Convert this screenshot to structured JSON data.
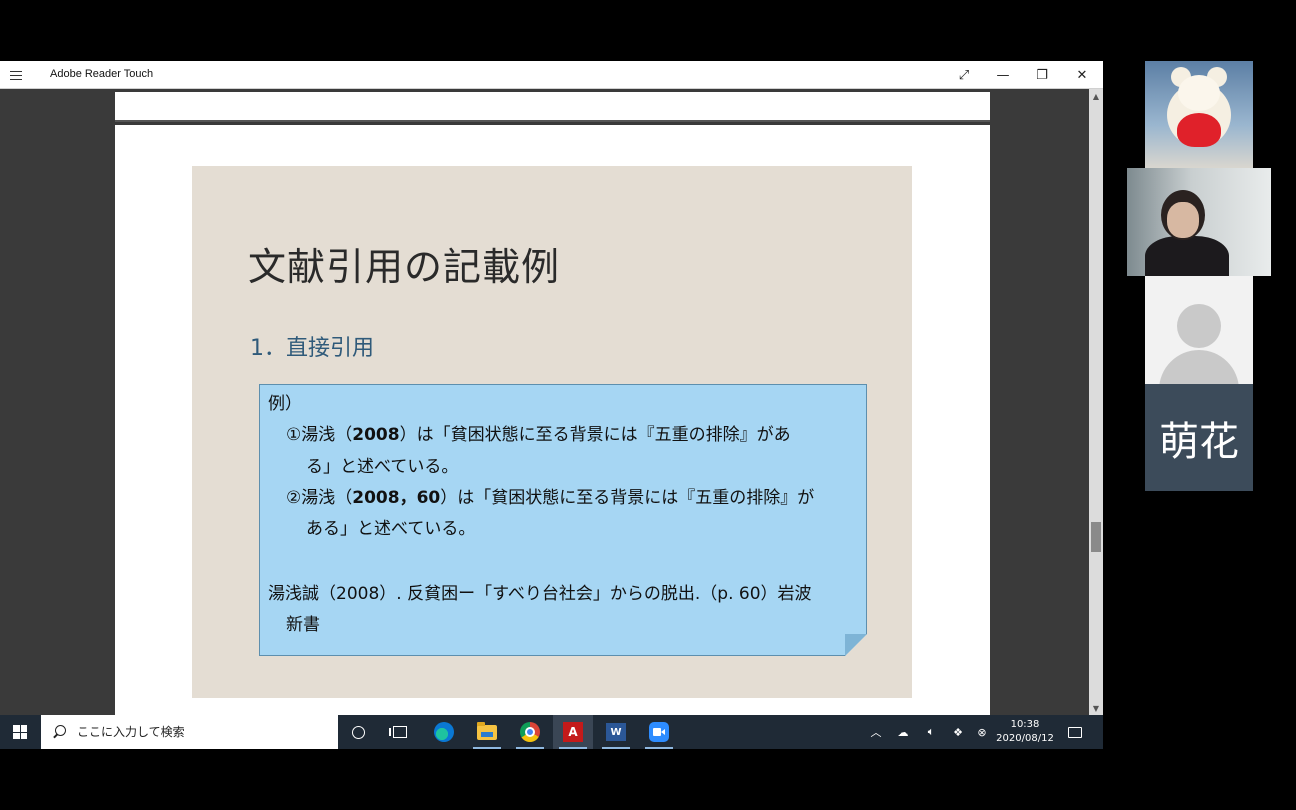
{
  "app": {
    "title": "Adobe Reader Touch",
    "window_buttons": {
      "fullscreen": "⤢",
      "minimize": "—",
      "restore": "❐",
      "close": "✕"
    }
  },
  "slide": {
    "title": "文献引用の記載例",
    "subtitle": "1．直接引用",
    "callout": {
      "label": "例）",
      "item1_a_pre": "①湯浅（",
      "item1_a_bold": "2008",
      "item1_a_post": "）は「貧困状態に至る背景には『五重の排除』があ",
      "item1_b": "る」と述べている。",
      "item2_a_pre": "②湯浅（",
      "item2_a_bold": "2008，60",
      "item2_a_post": "）は「貧困状態に至る背景には『五重の排除』が",
      "item2_b": "ある」と述べている。",
      "ref_a": "湯浅誠（2008）. 反貧困ー「すべり台社会」からの脱出.（p. 60）岩波",
      "ref_b": "新書"
    }
  },
  "taskbar": {
    "search_placeholder": "ここに入力して検索",
    "clock_time": "10:38",
    "clock_date": "2020/08/12"
  },
  "participants": {
    "name_label": "萌花"
  }
}
